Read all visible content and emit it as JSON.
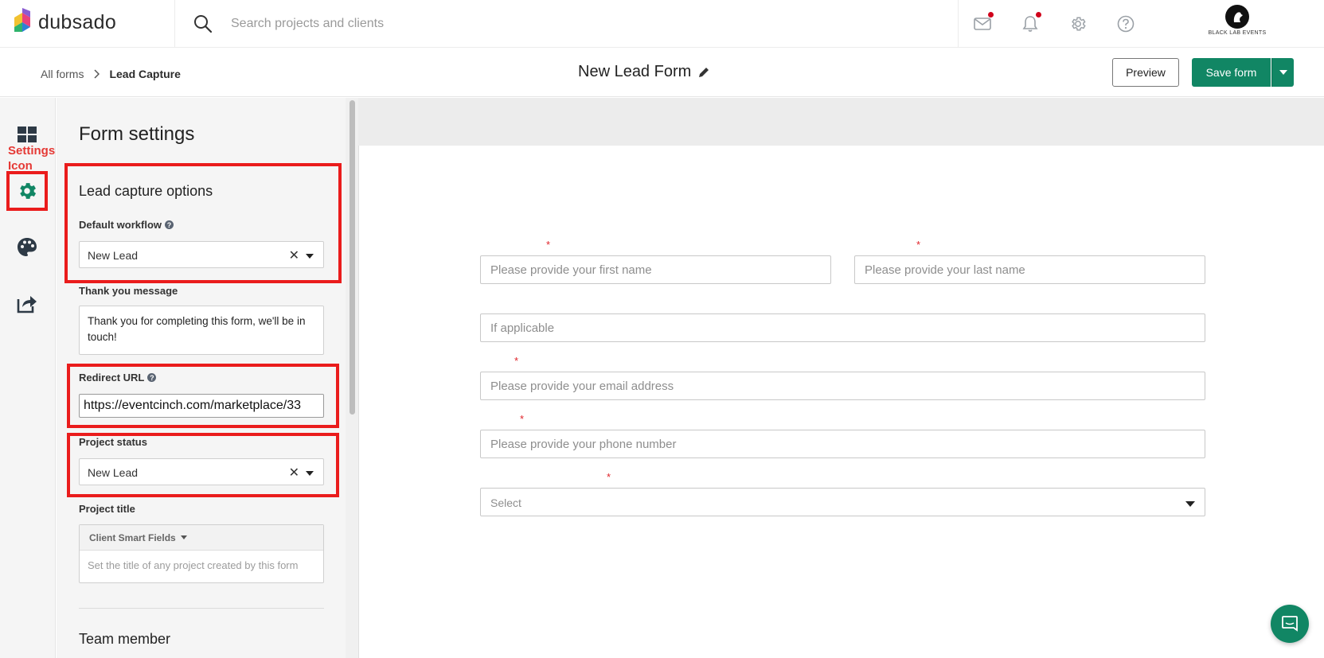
{
  "app": {
    "logo_text": "dubsado",
    "brand_name": "BLACK LAB EVENTS"
  },
  "search": {
    "placeholder": "Search projects and clients"
  },
  "breadcrumb": {
    "root": "All forms",
    "current": "Lead Capture"
  },
  "header": {
    "form_title": "New Lead Form",
    "preview_label": "Preview",
    "save_label": "Save form"
  },
  "annotation": {
    "settings_icon_label": "Settings Icon"
  },
  "rail": {
    "items": [
      "dashboard-icon",
      "gear-icon",
      "palette-icon",
      "share-icon"
    ]
  },
  "panel": {
    "title": "Form settings",
    "lead_capture_title": "Lead capture options",
    "default_workflow_label": "Default workflow",
    "default_workflow_value": "New Lead",
    "thank_you_label": "Thank you message",
    "thank_you_value": "Thank you for completing this form, we'll be in touch!",
    "redirect_label": "Redirect URL",
    "redirect_value": "https://eventcinch.com/marketplace/33",
    "project_status_label": "Project status",
    "project_status_value": "New Lead",
    "project_title_label": "Project title",
    "smart_fields_label": "Client Smart Fields",
    "project_title_placeholder": "Set the title of any project created by this form",
    "team_member_title": "Team member"
  },
  "form": {
    "first_name_placeholder": "Please provide your first name",
    "last_name_placeholder": "Please provide your last name",
    "company_placeholder": "If applicable",
    "email_placeholder": "Please provide your email address",
    "phone_placeholder": "Please provide your phone number",
    "select_value": "Select",
    "required_mark": "*"
  },
  "colors": {
    "accent": "#118664",
    "annotation": "#ea1c1c",
    "notification_dot": "#d0021b"
  }
}
